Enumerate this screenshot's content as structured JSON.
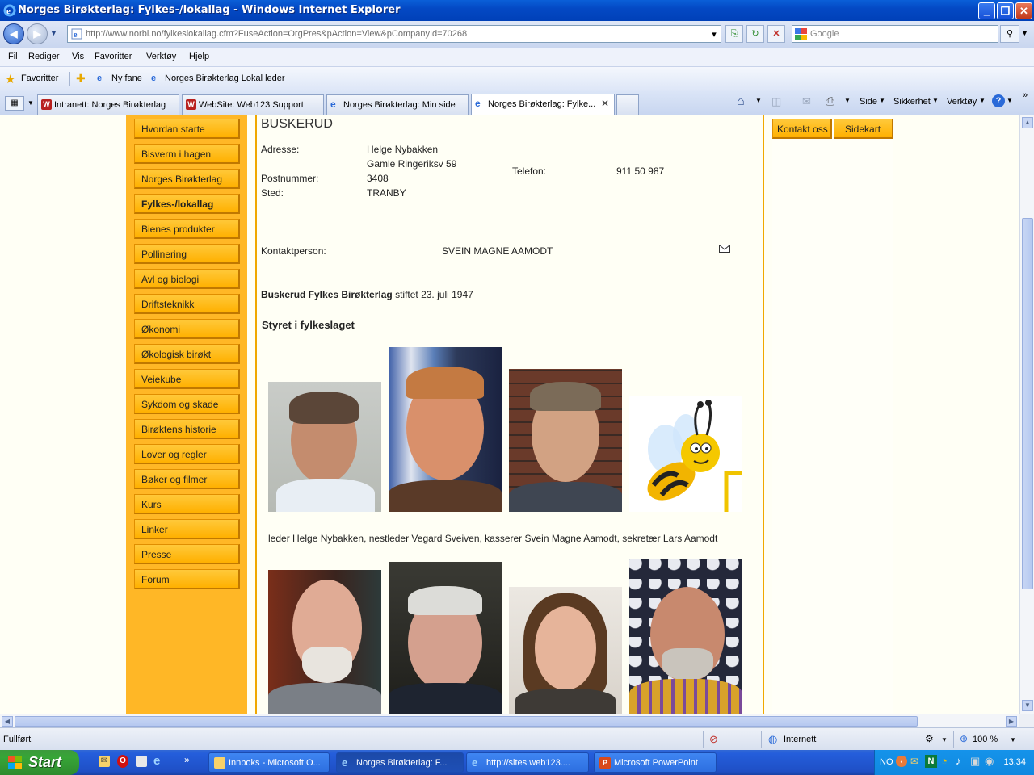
{
  "window": {
    "title": "Norges Birøkterlag: Fylkes-/lokallag - Windows Internet Explorer",
    "minimize": "_",
    "maximize": "❐",
    "close": "✕"
  },
  "address": {
    "url": "http://www.norbi.no/fylkeslokallag.cfm?FuseAction=OrgPres&pAction=View&pCompanyId=70268",
    "search_placeholder": "Google"
  },
  "menu": [
    "Fil",
    "Rediger",
    "Vis",
    "Favoritter",
    "Verktøy",
    "Hjelp"
  ],
  "favorites": {
    "label": "Favoritter",
    "items": [
      "Ny fane",
      "Norges Birøkterlag Lokal leder"
    ]
  },
  "tabs": [
    {
      "label": "Intranett: Norges Birøkterlag",
      "icon": "wordpress-icon"
    },
    {
      "label": "WebSite: Web123 Support",
      "icon": "wordpress-icon"
    },
    {
      "label": "Norges Birøkterlag: Min side",
      "icon": "ie-icon"
    },
    {
      "label": "Norges Birøkterlag: Fylke...",
      "icon": "ie-icon",
      "active": true
    }
  ],
  "commands": [
    "Side",
    "Sikkerhet",
    "Verktøy"
  ],
  "sidebar": {
    "items": [
      {
        "label": "Hvordan starte"
      },
      {
        "label": "Bisverm i hagen"
      },
      {
        "label": "Norges Birøkterlag"
      },
      {
        "label": "Fylkes-/lokallag",
        "active": true
      },
      {
        "label": "Bienes produkter"
      },
      {
        "label": "Pollinering"
      },
      {
        "label": "Avl og biologi"
      },
      {
        "label": "Driftsteknikk"
      },
      {
        "label": "Økonomi"
      },
      {
        "label": "Økologisk birøkt"
      },
      {
        "label": "Veiekube"
      },
      {
        "label": "Sykdom og skade"
      },
      {
        "label": "Birøktens historie"
      },
      {
        "label": "Lover og regler"
      },
      {
        "label": "Bøker og filmer"
      },
      {
        "label": "Kurs"
      },
      {
        "label": "Linker"
      },
      {
        "label": "Presse"
      },
      {
        "label": "Forum"
      }
    ]
  },
  "topright": {
    "contact": "Kontakt oss",
    "sitemap": "Sidekart"
  },
  "main": {
    "heading": "BUSKERUD",
    "address_label": "Adresse:",
    "address_name": "Helge Nybakken",
    "address_street": "Gamle Ringeriksv 59",
    "postnr_label": "Postnummer:",
    "postnr": "3408",
    "sted_label": "Sted:",
    "sted": "TRANBY",
    "phone_label": "Telefon:",
    "phone": "911 50 987",
    "contact_label": "Kontaktperson:",
    "contact_name": "SVEIN MAGNE AAMODT",
    "founded_bold": "Buskerud Fylkes Birøkterlag",
    "founded_rest": "stiftet 23. juli 1947",
    "board_heading": "Styret i fylkeslaget",
    "board_caption": "leder Helge Nybakken, nestleder Vegard Sveiven, kasserer Svein Magne Aamodt, sekretær Lars Aamodt"
  },
  "status": {
    "text": "Fullført",
    "zone": "Internett",
    "zoom": "100 %"
  },
  "taskbar": {
    "start": "Start",
    "items": [
      {
        "label": "Innboks - Microsoft O...",
        "icon": "outlook-icon"
      },
      {
        "label": "Norges Birøkterlag: F...",
        "icon": "ie-icon",
        "active": true
      },
      {
        "label": "http://sites.web123....",
        "icon": "ie-icon"
      },
      {
        "label": "Microsoft PowerPoint",
        "icon": "powerpoint-icon"
      }
    ],
    "tray_lang": "NO",
    "clock": "13:34"
  },
  "colors": {
    "orange": "#ffb726",
    "page_bg": "#fffff5",
    "titlebar": "#0a5fd8"
  }
}
